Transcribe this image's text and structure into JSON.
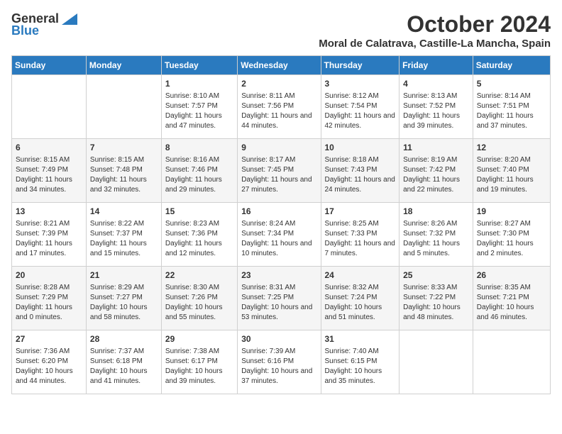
{
  "logo": {
    "general": "General",
    "blue": "Blue"
  },
  "title": "October 2024",
  "location": "Moral de Calatrava, Castille-La Mancha, Spain",
  "headers": [
    "Sunday",
    "Monday",
    "Tuesday",
    "Wednesday",
    "Thursday",
    "Friday",
    "Saturday"
  ],
  "weeks": [
    [
      {
        "day": "",
        "info": ""
      },
      {
        "day": "",
        "info": ""
      },
      {
        "day": "1",
        "info": "Sunrise: 8:10 AM\nSunset: 7:57 PM\nDaylight: 11 hours and 47 minutes."
      },
      {
        "day": "2",
        "info": "Sunrise: 8:11 AM\nSunset: 7:56 PM\nDaylight: 11 hours and 44 minutes."
      },
      {
        "day": "3",
        "info": "Sunrise: 8:12 AM\nSunset: 7:54 PM\nDaylight: 11 hours and 42 minutes."
      },
      {
        "day": "4",
        "info": "Sunrise: 8:13 AM\nSunset: 7:52 PM\nDaylight: 11 hours and 39 minutes."
      },
      {
        "day": "5",
        "info": "Sunrise: 8:14 AM\nSunset: 7:51 PM\nDaylight: 11 hours and 37 minutes."
      }
    ],
    [
      {
        "day": "6",
        "info": "Sunrise: 8:15 AM\nSunset: 7:49 PM\nDaylight: 11 hours and 34 minutes."
      },
      {
        "day": "7",
        "info": "Sunrise: 8:15 AM\nSunset: 7:48 PM\nDaylight: 11 hours and 32 minutes."
      },
      {
        "day": "8",
        "info": "Sunrise: 8:16 AM\nSunset: 7:46 PM\nDaylight: 11 hours and 29 minutes."
      },
      {
        "day": "9",
        "info": "Sunrise: 8:17 AM\nSunset: 7:45 PM\nDaylight: 11 hours and 27 minutes."
      },
      {
        "day": "10",
        "info": "Sunrise: 8:18 AM\nSunset: 7:43 PM\nDaylight: 11 hours and 24 minutes."
      },
      {
        "day": "11",
        "info": "Sunrise: 8:19 AM\nSunset: 7:42 PM\nDaylight: 11 hours and 22 minutes."
      },
      {
        "day": "12",
        "info": "Sunrise: 8:20 AM\nSunset: 7:40 PM\nDaylight: 11 hours and 19 minutes."
      }
    ],
    [
      {
        "day": "13",
        "info": "Sunrise: 8:21 AM\nSunset: 7:39 PM\nDaylight: 11 hours and 17 minutes."
      },
      {
        "day": "14",
        "info": "Sunrise: 8:22 AM\nSunset: 7:37 PM\nDaylight: 11 hours and 15 minutes."
      },
      {
        "day": "15",
        "info": "Sunrise: 8:23 AM\nSunset: 7:36 PM\nDaylight: 11 hours and 12 minutes."
      },
      {
        "day": "16",
        "info": "Sunrise: 8:24 AM\nSunset: 7:34 PM\nDaylight: 11 hours and 10 minutes."
      },
      {
        "day": "17",
        "info": "Sunrise: 8:25 AM\nSunset: 7:33 PM\nDaylight: 11 hours and 7 minutes."
      },
      {
        "day": "18",
        "info": "Sunrise: 8:26 AM\nSunset: 7:32 PM\nDaylight: 11 hours and 5 minutes."
      },
      {
        "day": "19",
        "info": "Sunrise: 8:27 AM\nSunset: 7:30 PM\nDaylight: 11 hours and 2 minutes."
      }
    ],
    [
      {
        "day": "20",
        "info": "Sunrise: 8:28 AM\nSunset: 7:29 PM\nDaylight: 11 hours and 0 minutes."
      },
      {
        "day": "21",
        "info": "Sunrise: 8:29 AM\nSunset: 7:27 PM\nDaylight: 10 hours and 58 minutes."
      },
      {
        "day": "22",
        "info": "Sunrise: 8:30 AM\nSunset: 7:26 PM\nDaylight: 10 hours and 55 minutes."
      },
      {
        "day": "23",
        "info": "Sunrise: 8:31 AM\nSunset: 7:25 PM\nDaylight: 10 hours and 53 minutes."
      },
      {
        "day": "24",
        "info": "Sunrise: 8:32 AM\nSunset: 7:24 PM\nDaylight: 10 hours and 51 minutes."
      },
      {
        "day": "25",
        "info": "Sunrise: 8:33 AM\nSunset: 7:22 PM\nDaylight: 10 hours and 48 minutes."
      },
      {
        "day": "26",
        "info": "Sunrise: 8:35 AM\nSunset: 7:21 PM\nDaylight: 10 hours and 46 minutes."
      }
    ],
    [
      {
        "day": "27",
        "info": "Sunrise: 7:36 AM\nSunset: 6:20 PM\nDaylight: 10 hours and 44 minutes."
      },
      {
        "day": "28",
        "info": "Sunrise: 7:37 AM\nSunset: 6:18 PM\nDaylight: 10 hours and 41 minutes."
      },
      {
        "day": "29",
        "info": "Sunrise: 7:38 AM\nSunset: 6:17 PM\nDaylight: 10 hours and 39 minutes."
      },
      {
        "day": "30",
        "info": "Sunrise: 7:39 AM\nSunset: 6:16 PM\nDaylight: 10 hours and 37 minutes."
      },
      {
        "day": "31",
        "info": "Sunrise: 7:40 AM\nSunset: 6:15 PM\nDaylight: 10 hours and 35 minutes."
      },
      {
        "day": "",
        "info": ""
      },
      {
        "day": "",
        "info": ""
      }
    ]
  ]
}
